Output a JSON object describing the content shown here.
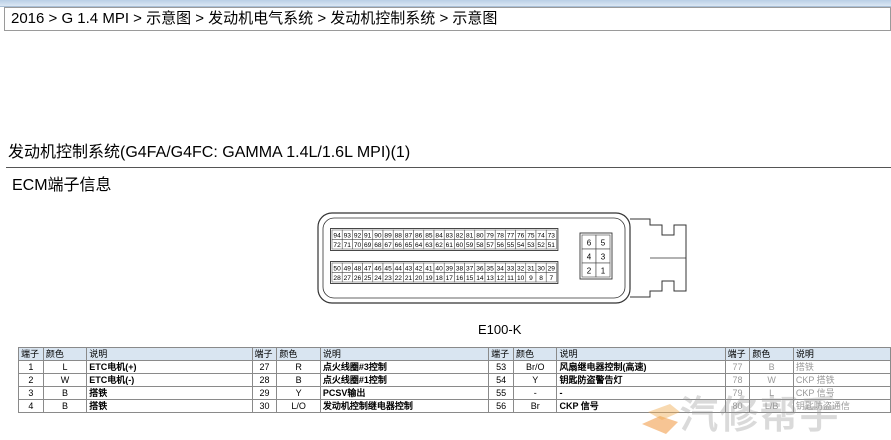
{
  "breadcrumb": "2016 > G 1.4 MPI > 示意图 > 发动机电气系统 > 发动机控制系统 > 示意图",
  "doc_title": "发动机控制系统(G4FA/G4FC: GAMMA 1.4L/1.6L MPI)(1)",
  "section_title": "ECM端子信息",
  "connector": {
    "label": "E100-K",
    "rows": [
      [
        "94",
        "93",
        "92",
        "91",
        "90",
        "89",
        "88",
        "87",
        "86",
        "85",
        "84",
        "83",
        "82",
        "81",
        "80",
        "79",
        "78",
        "77",
        "76",
        "75",
        "74",
        "73"
      ],
      [
        "72",
        "71",
        "70",
        "69",
        "68",
        "67",
        "66",
        "65",
        "64",
        "63",
        "62",
        "61",
        "60",
        "59",
        "58",
        "57",
        "56",
        "55",
        "54",
        "53",
        "52",
        "51"
      ],
      [
        "50",
        "49",
        "48",
        "47",
        "46",
        "45",
        "44",
        "43",
        "42",
        "41",
        "40",
        "39",
        "38",
        "37",
        "36",
        "35",
        "34",
        "33",
        "32",
        "31",
        "30",
        "29"
      ],
      [
        "28",
        "27",
        "26",
        "25",
        "24",
        "23",
        "22",
        "21",
        "20",
        "19",
        "18",
        "17",
        "16",
        "15",
        "14",
        "13",
        "12",
        "11",
        "10",
        "9",
        "8",
        "7"
      ]
    ],
    "side_pins": [
      [
        "6",
        "5"
      ],
      [
        "4",
        "3"
      ],
      [
        "2",
        "1"
      ]
    ]
  },
  "table": {
    "headers": [
      "端子",
      "颜色",
      "说明"
    ],
    "rows": [
      [
        [
          "1",
          "L",
          "ETC电机(+)"
        ],
        [
          "27",
          "R",
          "点火线圈#3控制"
        ],
        [
          "53",
          "Br/O",
          "风扇继电器控制(高速)"
        ],
        [
          "77",
          "B",
          "搭铁"
        ]
      ],
      [
        [
          "2",
          "W",
          "ETC电机(-)"
        ],
        [
          "28",
          "B",
          "点火线圈#1控制"
        ],
        [
          "54",
          "Y",
          "钥匙防盗警告灯"
        ],
        [
          "78",
          "W",
          "CKP 搭铁"
        ]
      ],
      [
        [
          "3",
          "B",
          "搭铁"
        ],
        [
          "29",
          "Y",
          "PCSV输出"
        ],
        [
          "55",
          "-",
          "-"
        ],
        [
          "79",
          "L",
          "CKP 信号"
        ]
      ],
      [
        [
          "4",
          "B",
          "搭铁"
        ],
        [
          "30",
          "L/O",
          "发动机控制继电器控制"
        ],
        [
          "56",
          "Br",
          "CKP 信号"
        ],
        [
          "80",
          "L/B",
          "钥匙防盗通信"
        ]
      ]
    ]
  },
  "watermark": "汽修帮手"
}
